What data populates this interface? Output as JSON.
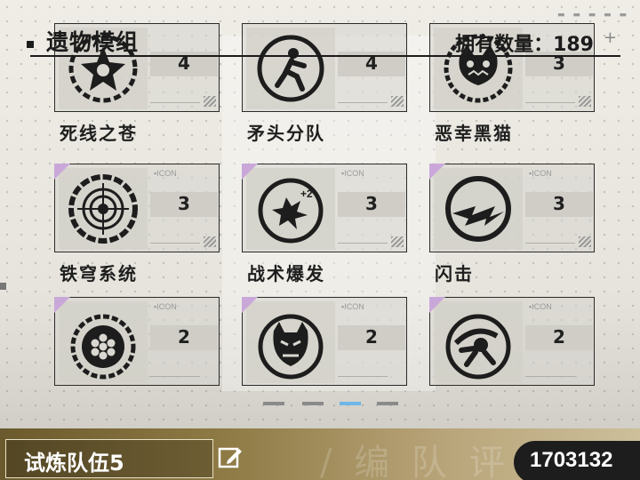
{
  "header": {
    "title": "遗物模组",
    "count_label": "拥有数量：189",
    "plus": "+"
  },
  "cards": [
    {
      "name": "死线之苍",
      "count": "4",
      "icon_tag": "",
      "emblem": "spiked-star-icon"
    },
    {
      "name": "矛头分队",
      "count": "4",
      "icon_tag": "",
      "emblem": "running-figure-icon"
    },
    {
      "name": "恶幸黑猫",
      "count": "3",
      "icon_tag": "",
      "emblem": "black-cat-face-icon"
    },
    {
      "name": "铁穹系统",
      "count": "3",
      "icon_tag": "ICON",
      "emblem": "crosshair-shield-icon"
    },
    {
      "name": "战术爆发",
      "count": "3",
      "icon_tag": "ICON",
      "emblem": "explosion-plus2-icon"
    },
    {
      "name": "闪击",
      "count": "3",
      "icon_tag": "ICON",
      "emblem": "lightning-bolt-icon"
    },
    {
      "name": "",
      "count": "2",
      "icon_tag": "ICON",
      "emblem": "hexagon-cluster-icon"
    },
    {
      "name": "",
      "count": "2",
      "icon_tag": "ICON",
      "emblem": "oni-mask-icon"
    },
    {
      "name": "",
      "count": "2",
      "icon_tag": "ICON",
      "emblem": "charging-figure-icon"
    }
  ],
  "pager": {
    "pages": 4,
    "active": 3
  },
  "footer": {
    "team_name": "试炼队伍5",
    "edit_icon": "edit-icon",
    "score": "1703132",
    "bg_text": "/ 编 队 评"
  },
  "colors": {
    "rarity_corner": "#c9a8d9",
    "pager_active": "#6fb6e8",
    "footer_gold": "#8e7a44"
  }
}
